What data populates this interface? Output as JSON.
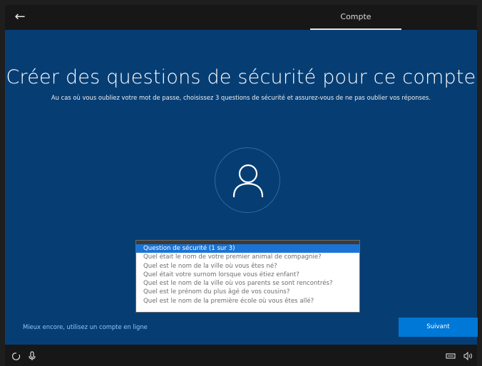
{
  "header": {
    "tab_label": "Compte"
  },
  "main": {
    "title": "Créer des questions de sécurité pour ce compte",
    "subtitle": "Au cas où vous oubliez votre mot de passe, choisissez 3 questions de sécurité et assurez-vous de ne pas oublier vos réponses."
  },
  "dropdown": {
    "options": [
      "Question de sécurité (1 sur 3)",
      "Quel était le nom de votre premier animal de compagnie?",
      "Quel est le nom de la ville où vous êtes né?",
      "Quel était votre surnom lorsque vous étiez enfant?",
      "Quel est le nom de la ville où vos parents se sont rencontrés?",
      "Quel est le prénom du plus âgé de vos cousins?",
      "Quel est le nom de la première école où vous êtes allé?"
    ],
    "selected_index": 0
  },
  "footer": {
    "online_account_link": "Mieux encore, utilisez un compte en ligne",
    "next_label": "Suivant"
  },
  "colors": {
    "background": "#063e74",
    "selected_option": "#1a74d6",
    "button": "#0078d7",
    "link": "#8fc6ff"
  },
  "icons": {
    "back": "back-arrow-icon",
    "avatar": "user-avatar-icon",
    "accessibility": "ease-of-access-icon",
    "microphone": "microphone-icon",
    "keyboard": "keyboard-icon",
    "volume": "volume-icon"
  }
}
